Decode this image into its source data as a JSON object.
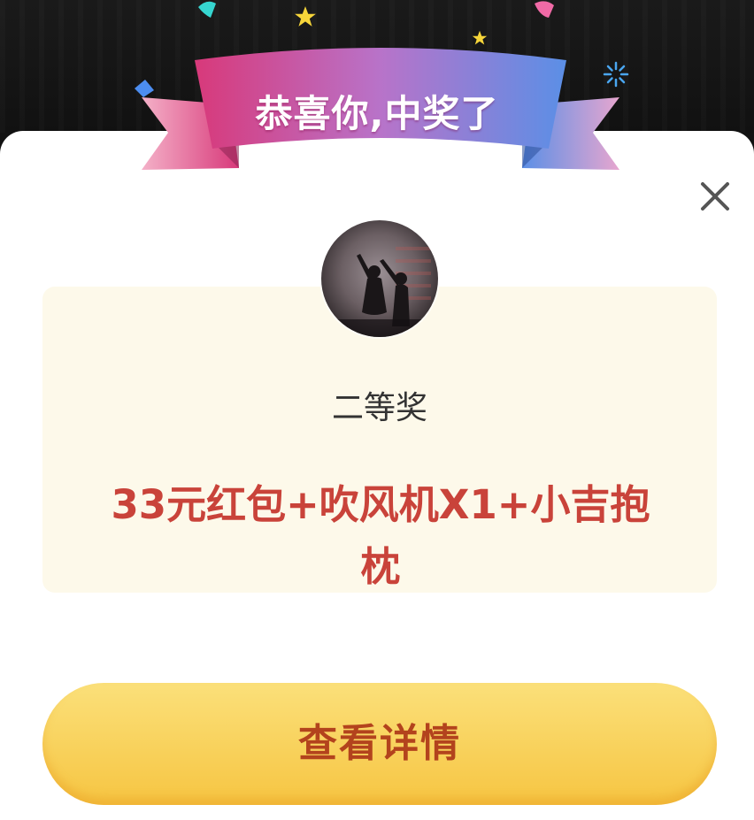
{
  "banner": {
    "title": "恭喜你,中奖了"
  },
  "dialog": {
    "close_icon": "close-icon",
    "avatar_icon": "avatar-image",
    "prize_level": "二等奖",
    "prize_description": "33元红包+吹风机X1+小吉抱枕",
    "detail_button_label": "查看详情"
  },
  "colors": {
    "banner_pink": "#e0457f",
    "banner_blue": "#5b8fe6",
    "prize_text": "#c9433a",
    "prize_box_bg": "#fdf9ea",
    "button_gold": "#f6c542",
    "button_text": "#b3431d"
  }
}
